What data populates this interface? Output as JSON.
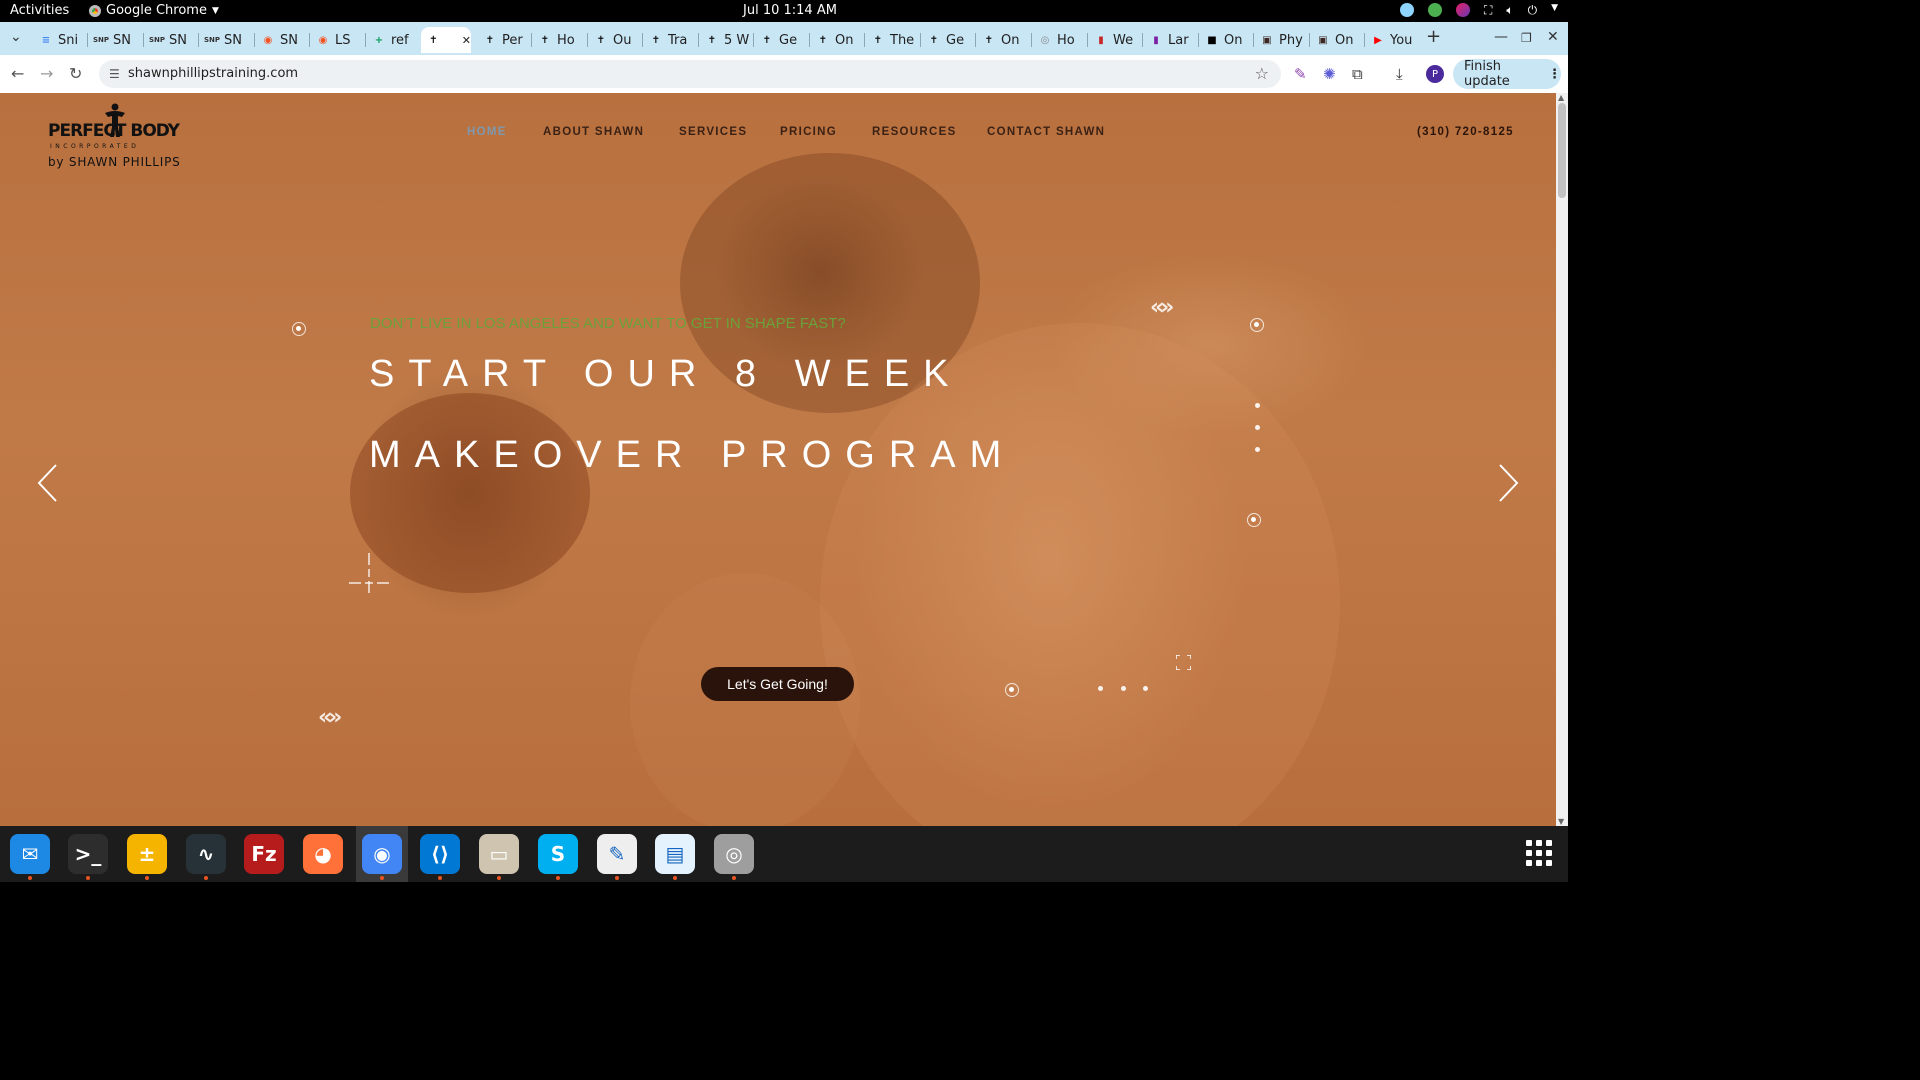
{
  "system": {
    "activities": "Activities",
    "app_name": "Google Chrome",
    "datetime": "Jul 10  1:14 AM"
  },
  "tabs": [
    {
      "label": "Sni",
      "icon": "docs-icon",
      "color": "#4285f4"
    },
    {
      "label": "SN",
      "icon": "snp-icon",
      "color": "#333333"
    },
    {
      "label": "SN",
      "icon": "snp-icon",
      "color": "#333333"
    },
    {
      "label": "SN",
      "icon": "snp-icon",
      "color": "#333333"
    },
    {
      "label": "SN",
      "icon": "orange-swirl-icon",
      "color": "#f4511e"
    },
    {
      "label": "LS",
      "icon": "orange-swirl-icon",
      "color": "#f4511e"
    },
    {
      "label": "ref",
      "icon": "sheets-icon",
      "color": "#0f9d58"
    },
    {
      "label": "",
      "icon": "site-icon",
      "color": "#111111",
      "active": true
    },
    {
      "label": "Per",
      "icon": "site-icon",
      "color": "#111111"
    },
    {
      "label": "Ho",
      "icon": "site-icon",
      "color": "#111111"
    },
    {
      "label": "Ou",
      "icon": "site-icon",
      "color": "#111111"
    },
    {
      "label": "Tra",
      "icon": "site-icon",
      "color": "#111111"
    },
    {
      "label": "5 W",
      "icon": "site-icon",
      "color": "#111111"
    },
    {
      "label": "Ge",
      "icon": "site-icon",
      "color": "#111111"
    },
    {
      "label": "On",
      "icon": "site-icon",
      "color": "#111111"
    },
    {
      "label": "The",
      "icon": "site-icon",
      "color": "#111111"
    },
    {
      "label": "Ge",
      "icon": "site-icon",
      "color": "#111111"
    },
    {
      "label": "On",
      "icon": "site-icon",
      "color": "#111111"
    },
    {
      "label": "Ho",
      "icon": "globe-icon",
      "color": "#888888"
    },
    {
      "label": "We",
      "icon": "colorful-icon",
      "color": "#c62828"
    },
    {
      "label": "Lar",
      "icon": "colorful-icon",
      "color": "#7b1fa2"
    },
    {
      "label": "On",
      "icon": "black-square-icon",
      "color": "#000000"
    },
    {
      "label": "Phy",
      "icon": "dark-logo-icon",
      "color": "#3e2723"
    },
    {
      "label": "On",
      "icon": "dark-logo-icon",
      "color": "#3e2723"
    },
    {
      "label": "You",
      "icon": "youtube-icon",
      "color": "#ff0000"
    }
  ],
  "address_bar": {
    "url": "shawnphillipstraining.com",
    "finish_update": "Finish update",
    "profile_initial": "P"
  },
  "site": {
    "logo": {
      "brand": "PERFECT BODY",
      "incorporated": "INCORPORATED",
      "byline": "by SHAWN PHILLIPS"
    },
    "nav": [
      {
        "label": "HOME",
        "active": true
      },
      {
        "label": "ABOUT SHAWN"
      },
      {
        "label": "SERVICES"
      },
      {
        "label": "PRICING"
      },
      {
        "label": "RESOURCES"
      },
      {
        "label": "CONTACT SHAWN"
      }
    ],
    "phone": "(310) 720-8125",
    "hero": {
      "eyebrow": "DON’T LIVE IN LOS ANGELES AND WANT TO GET IN SHAPE FAST?",
      "headline_line1": "START OUR 8 WEEK",
      "headline_line2": "MAKEOVER PROGRAM",
      "cta": "Let's Get Going!"
    },
    "colors": {
      "overlay": "#b8703f",
      "eyebrow": "#6ba13a",
      "cta_bg": "#2a130b",
      "nav_active": "#7f98ad"
    }
  },
  "dock": [
    {
      "name": "thunderbird-icon",
      "running": true
    },
    {
      "name": "terminal-icon",
      "running": true
    },
    {
      "name": "calculator-icon",
      "running": true
    },
    {
      "name": "system-monitor-icon",
      "running": true
    },
    {
      "name": "filezilla-icon",
      "running": false
    },
    {
      "name": "firefox-icon",
      "running": false
    },
    {
      "name": "chrome-icon",
      "running": true
    },
    {
      "name": "vscode-icon",
      "running": true
    },
    {
      "name": "files-icon",
      "running": true
    },
    {
      "name": "skype-icon",
      "running": true
    },
    {
      "name": "text-editor-icon",
      "running": true
    },
    {
      "name": "document-viewer-icon",
      "running": true
    },
    {
      "name": "disk-icon",
      "running": true
    }
  ]
}
